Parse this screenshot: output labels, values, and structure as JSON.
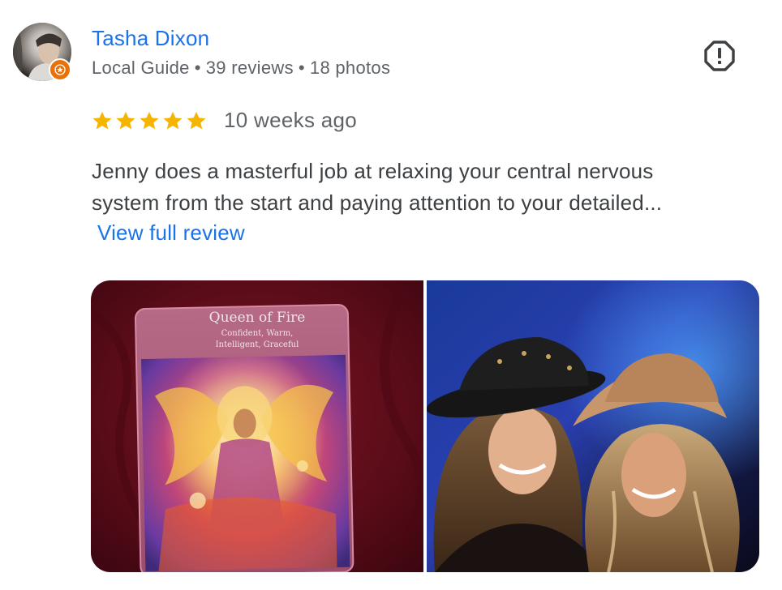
{
  "reviewer": {
    "name": "Tasha Dixon",
    "badge": "Local Guide",
    "separator": "•",
    "reviews": "39 reviews",
    "photos": "18 photos",
    "avatar_icon": "profile-photo",
    "badge_icon": "local-guide-star-badge"
  },
  "review": {
    "rating": 5,
    "rating_max": 5,
    "star_color": "#f4b400",
    "time_ago": "10 weeks ago",
    "text_lines": [
      "Jenny does a masterful job at relaxing your central nervous",
      "system from the start and paying attention to your detailed..."
    ],
    "view_full_label": "View full review"
  },
  "actions": {
    "report_icon": "report-exclamation-icon"
  },
  "photos": [
    {
      "card_title": "Queen of Fire",
      "card_subtitle_1": "Confident, Warm,",
      "card_subtitle_2": "Intelligent, Graceful"
    },
    {
      "subject": "two-women-in-hats"
    }
  ],
  "colors": {
    "link": "#1a73e8",
    "secondary_text": "#5f6368",
    "badge": "#e8710a",
    "star": "#f4b400"
  }
}
